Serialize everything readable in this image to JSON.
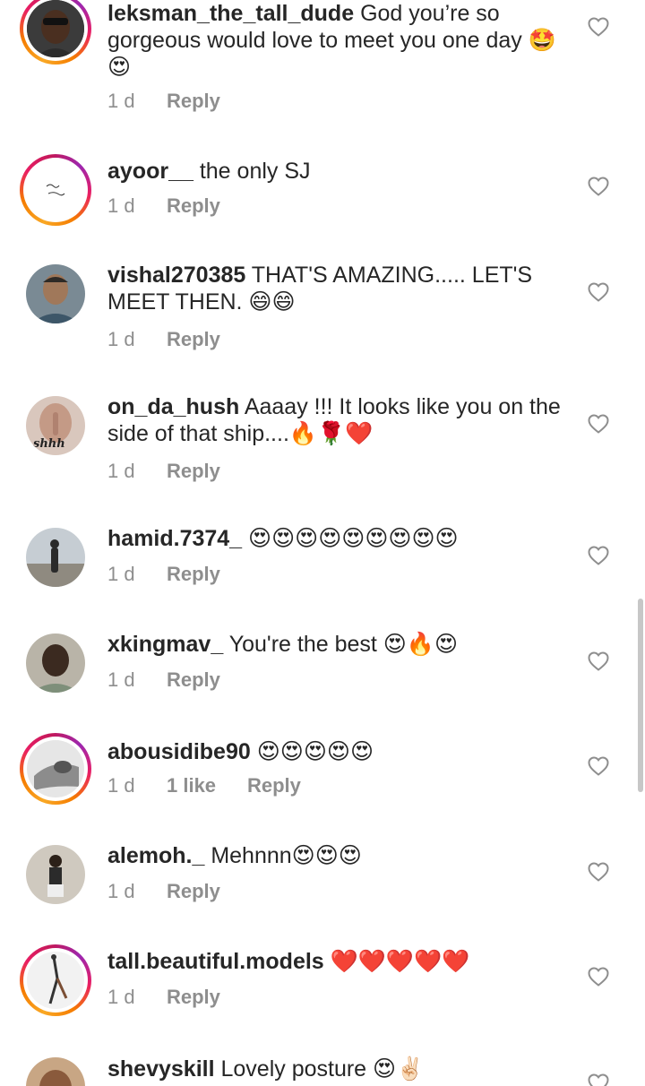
{
  "comments": [
    {
      "username": "leksman_the_tall_dude",
      "text": " God you’re so gorgeous would love to meet you one day 🤩😍",
      "time": "1 d",
      "reply": "Reply",
      "avatar_icon": "profile-photo",
      "ring": true
    },
    {
      "username": "ayoor__",
      "text": " the only SJ",
      "time": "1 d",
      "reply": "Reply",
      "avatar_icon": "signature-logo",
      "ring": true
    },
    {
      "username": "vishal270385",
      "text": " THAT'S AMAZING..... LET'S MEET THEN. 😄😄",
      "time": "1 d",
      "reply": "Reply",
      "avatar_icon": "profile-photo",
      "ring": false
    },
    {
      "username": "on_da_hush",
      "text": " Aaaay !!! It looks like you on the side of that ship....🔥🌹❤️",
      "time": "1 d",
      "reply": "Reply",
      "avatar_icon": "shhh-photo",
      "avatar_caption": "shhh",
      "ring": false
    },
    {
      "username": "hamid.7374_",
      "text": " 😍😍😍😍😍😍😍😍😍",
      "time": "1 d",
      "reply": "Reply",
      "avatar_icon": "beach-photo",
      "ring": false
    },
    {
      "username": "xkingmav_",
      "text": " You're the best 😍🔥😍",
      "time": "1 d",
      "reply": "Reply",
      "avatar_icon": "profile-photo",
      "ring": false
    },
    {
      "username": "abousidibe90",
      "text": " 😍😍😍😍😍",
      "time": "1 d",
      "likes": "1 like",
      "reply": "Reply",
      "avatar_icon": "bw-photo",
      "ring": true
    },
    {
      "username": "alemoh._",
      "text": " Mehnnn😍😍😍",
      "time": "1 d",
      "reply": "Reply",
      "avatar_icon": "profile-photo",
      "ring": false
    },
    {
      "username": "tall.beautiful.models",
      "text": " ❤️❤️❤️❤️❤️",
      "time": "1 d",
      "reply": "Reply",
      "avatar_icon": "dance-photo",
      "ring": true
    },
    {
      "username": "shevyskill",
      "text": " Lovely posture 😍✌🏻",
      "avatar_icon": "profile-photo",
      "ring": false
    }
  ],
  "colors": {
    "text": "#262626",
    "meta": "#8e8e8e",
    "heart_outline": "#8e8e8e"
  }
}
